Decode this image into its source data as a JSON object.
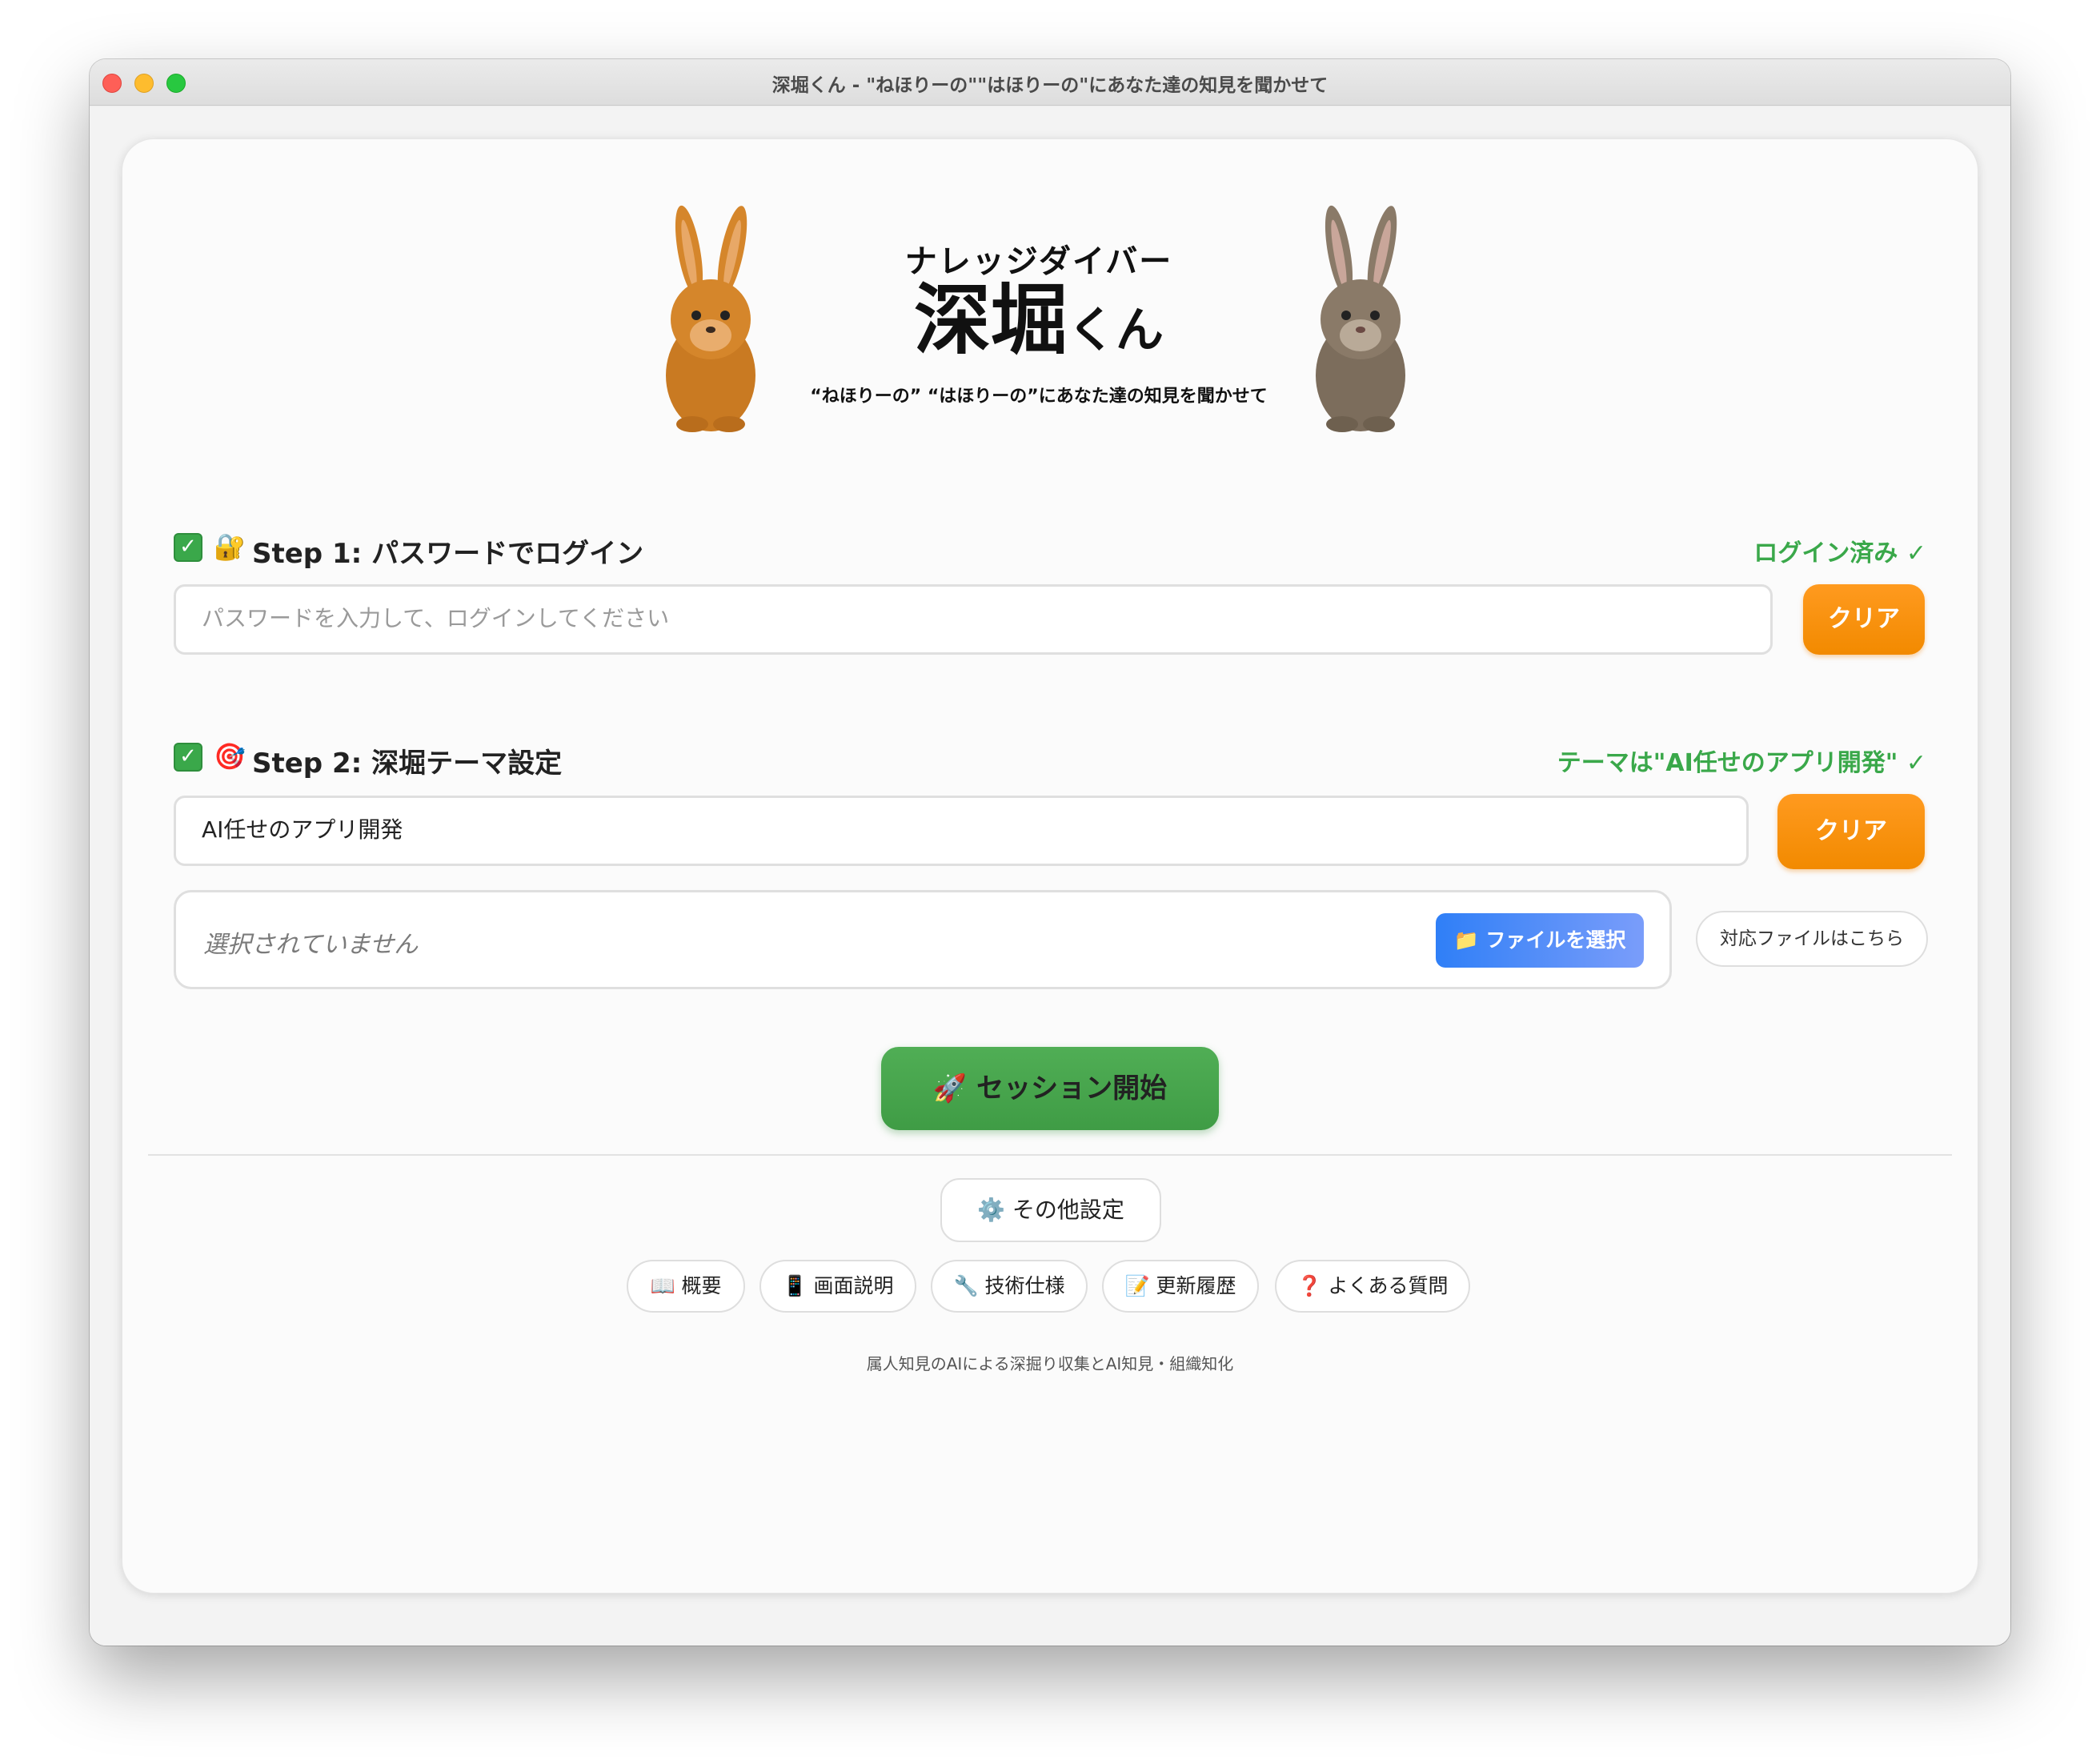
{
  "window": {
    "title": "深堀くん - \"ねほりーの\"\"はほりーの\"にあなた達の知見を聞かせて"
  },
  "header": {
    "kana": "ナレッジダイバー",
    "title_main": "深堀",
    "title_suffix": "くん",
    "subtitle": "“ねほりーの” “はほりーの”にあなた達の知見を聞かせて"
  },
  "step1": {
    "check": "✓",
    "emoji": "🔐",
    "title": "Step 1: パスワードでログイン",
    "status": "ログイン済み ✓",
    "input_placeholder": "パスワードを入力して、ログインしてください",
    "clear_label": "クリア"
  },
  "step2": {
    "check": "✓",
    "emoji": "🎯",
    "title": "Step 2: 深堀テーマ設定",
    "status": "テーマは\"AI任せのアプリ開発\" ✓",
    "input_value": "AI任せのアプリ開発",
    "clear_label": "クリア",
    "file_status": "選択されていません",
    "file_select_label": "📁 ファイルを選択",
    "support_label": "対応ファイルはこちら"
  },
  "start": {
    "label": "🚀 セッション開始"
  },
  "settings": {
    "label": "⚙️ その他設定"
  },
  "links": [
    {
      "label": "📖 概要"
    },
    {
      "label": "📱 画面説明"
    },
    {
      "label": "🔧 技術仕様"
    },
    {
      "label": "📝 更新履歴"
    },
    {
      "label": "❓ よくある質問"
    }
  ],
  "footer": {
    "note": "属人知見のAIによる深掘り収集とAI知見・組織知化"
  },
  "colors": {
    "green": "#3aa84a",
    "orange": "#f28a00",
    "blue": "#2f7ff7",
    "rabbit_left": "#d5862b",
    "rabbit_right": "#8a7a68"
  }
}
